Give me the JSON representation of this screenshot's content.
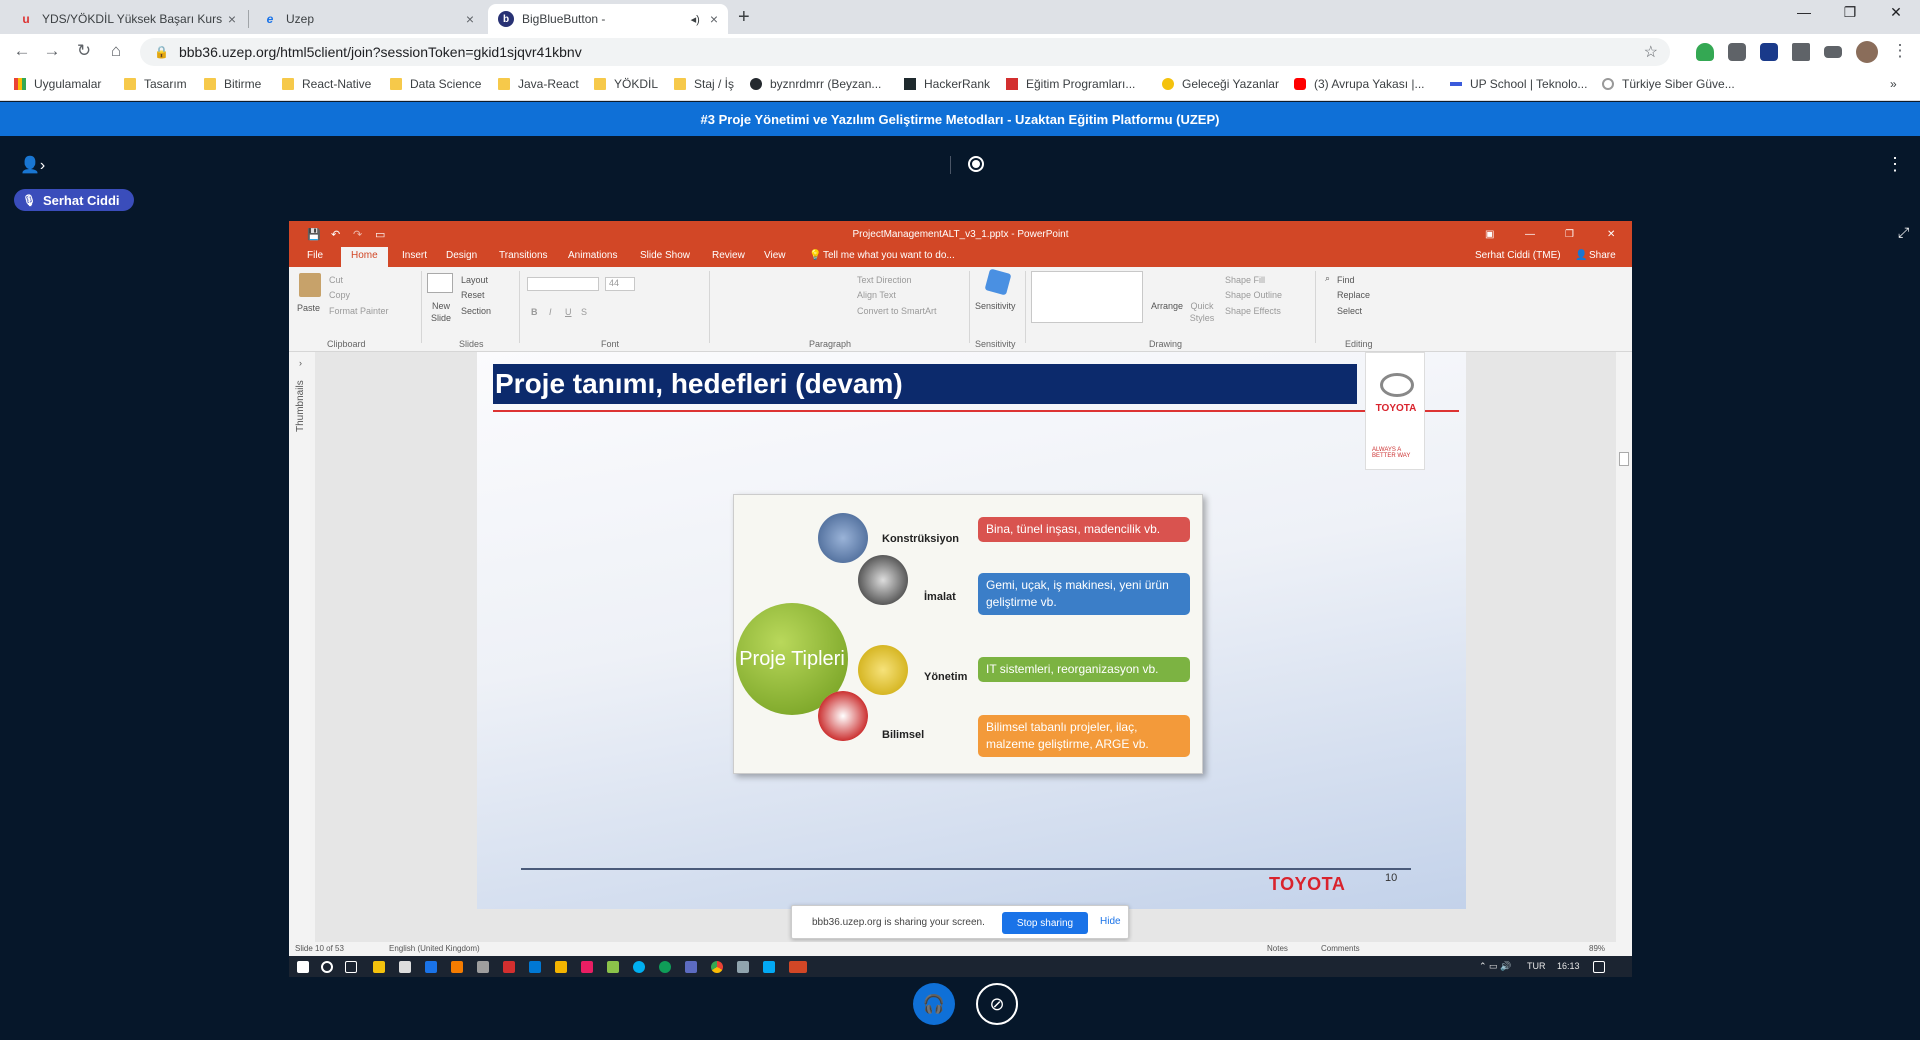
{
  "browser": {
    "tabs": [
      {
        "title": "YDS/YÖKDİL Yüksek Başarı Kursu",
        "close": "×"
      },
      {
        "title": "Uzep",
        "close": "×"
      },
      {
        "title": "BigBlueButton -",
        "close": "×"
      }
    ],
    "new_tab": "+",
    "url": "bbb36.uzep.org/html5client/join?sessionToken=gkid1sjqvr41kbnv",
    "bookmarks": [
      "Uygulamalar",
      "Tasarım",
      "Bitirme",
      "React-Native",
      "Data Science",
      "Java-React",
      "YÖKDİL",
      "Staj / İş",
      "byznrdmrr (Beyzan...",
      "HackerRank",
      "Eğitim Programları...",
      "Geleceği Yazanlar",
      "(3) Avrupa Yakası |...",
      "UP School | Teknolo...",
      "Türkiye Siber Güve..."
    ]
  },
  "bbb": {
    "title": "#3 Proje Yönetimi ve Yazılım Geliştirme Metodları - Uzaktan Eğitim Platformu (UZEP)",
    "user": "Serhat Ciddi"
  },
  "powerpoint": {
    "window_title": "ProjectManagementALT_v3_1.pptx - PowerPoint",
    "user": "Serhat Ciddi (TME)",
    "share": "Share",
    "tabs": [
      "File",
      "Home",
      "Insert",
      "Design",
      "Transitions",
      "Animations",
      "Slide Show",
      "Review",
      "View"
    ],
    "tell_me": "Tell me what you want to do...",
    "ribbon": {
      "paste": "Paste",
      "cut": "Cut",
      "copy": "Copy",
      "format_painter": "Format Painter",
      "new_slide": "New Slide",
      "layout": "Layout",
      "reset": "Reset",
      "section": "Section",
      "font_size": "44",
      "text_direction": "Text Direction",
      "align_text": "Align Text",
      "convert_smartart": "Convert to SmartArt",
      "sensitivity": "Sensitivity",
      "arrange": "Arrange",
      "quick_styles": "Quick Styles",
      "shape_fill": "Shape Fill",
      "shape_outline": "Shape Outline",
      "shape_effects": "Shape Effects",
      "find": "Find",
      "replace": "Replace",
      "select": "Select",
      "groups": [
        "Clipboard",
        "Slides",
        "Font",
        "Paragraph",
        "Sensitivity",
        "Drawing",
        "Editing"
      ]
    },
    "thumbnails_label": "Thumbnails",
    "slide": {
      "title": "Proje tanımı, hedefleri  (devam)",
      "logo_text": "TOYOTA",
      "logo_tagline": "ALWAYS A BETTER WAY",
      "hub": "Proje Tipleri",
      "categories": [
        {
          "name": "Konstrüksiyon",
          "desc": "Bina, tünel inşası, madencilik vb.",
          "color": "#d9534f"
        },
        {
          "name": "İmalat",
          "desc": "Gemi, uçak, iş makinesi, yeni ürün geliştirme vb.",
          "color": "#3b7ec8"
        },
        {
          "name": "Yönetim",
          "desc": "IT sistemleri, reorganizasyon vb.",
          "color": "#7cb342"
        },
        {
          "name": "Bilimsel",
          "desc": "Bilimsel tabanlı projeler, ilaç, malzeme geliştirme, ARGE vb.",
          "color": "#f39a3a"
        }
      ],
      "brand": "TOYOTA",
      "number": "10"
    },
    "share_notice": {
      "text": "bbb36.uzep.org is sharing your screen.",
      "stop": "Stop sharing",
      "hide": "Hide"
    },
    "status": {
      "slide": "Slide 10 of 53",
      "language": "English (United Kingdom)",
      "notes": "Notes",
      "comments": "Comments",
      "zoom": "89%"
    },
    "taskbar": {
      "lang": "TUR",
      "time": "16:13"
    }
  }
}
